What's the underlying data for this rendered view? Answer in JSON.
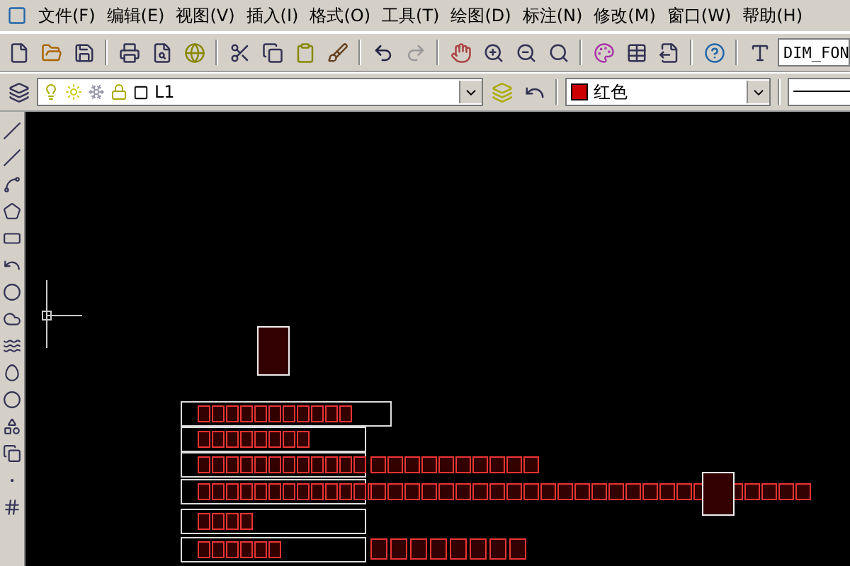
{
  "menu_bar": {
    "items": [
      {
        "label": "文件(F)"
      },
      {
        "label": "编辑(E)"
      },
      {
        "label": "视图(V)"
      },
      {
        "label": "插入(I)"
      },
      {
        "label": "格式(O)"
      },
      {
        "label": "工具(T)"
      },
      {
        "label": "绘图(D)"
      },
      {
        "label": "标注(N)"
      },
      {
        "label": "修改(M)"
      },
      {
        "label": "窗口(W)"
      },
      {
        "label": "帮助(H)"
      }
    ]
  },
  "standard_toolbar": {
    "text_style": "DIM_FON"
  },
  "layers_toolbar": {
    "layer": "L1",
    "color_name": "红色",
    "color": "#cc0000"
  }
}
